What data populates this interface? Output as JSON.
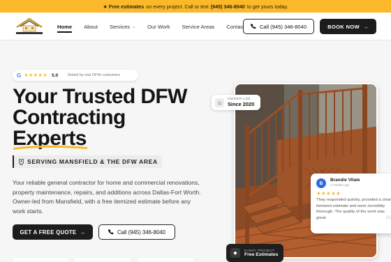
{
  "topbar": {
    "lead": "★ Free estimates",
    "middle": "on every project. Call or text",
    "phone": "(945) 346-8040",
    "tail": "to get yours today."
  },
  "nav": {
    "items": [
      {
        "label": "Home",
        "active": true
      },
      {
        "label": "About"
      },
      {
        "label": "Services",
        "has_dropdown": true
      },
      {
        "label": "Our Work"
      },
      {
        "label": "Service Areas"
      },
      {
        "label": "Contact"
      }
    ],
    "call_label": "Call (945) 346-8040",
    "book_label": "BOOK NOW"
  },
  "hero": {
    "rating_source": "G",
    "rating_stars": "★★★★★",
    "rating_score": "5.0",
    "rating_sub": "Rated by real DFW customers",
    "headline": [
      "Your Trusted DFW",
      "Contracting",
      "Experts"
    ],
    "area_tag": "SERVING MANSFIELD & THE DFW AREA",
    "description": "Your reliable general contractor for home and commercial renovations, property maintenance, repairs, and additions across Dallas-Fort Worth. Owner-led from Mansfield, with a free itemized estimate before any work starts.",
    "quote_button": "GET A FREE QUOTE",
    "call_button": "Call (945) 346-8040"
  },
  "badges": {
    "owner_small": "OWNER-LED",
    "owner_big": "Since 2020",
    "estimate_small": "EVERY PROJECT",
    "estimate_big": "Free Estimates"
  },
  "review": {
    "initial": "B",
    "name": "Brandie Vitale",
    "time": "4 months ago",
    "stars": "★★★★★",
    "text": "They responded quickly, provided a clear, itemized estimate and were incredibly thorough. The quality of the work was great."
  },
  "colors": {
    "accent": "#fbb829",
    "dark": "#1c1c1c",
    "wood": "#a2552a"
  },
  "icons": {
    "logo": "house-roof-logo",
    "call": "phone-icon",
    "arrow": "arrow-right-icon",
    "pin": "location-pin-icon",
    "home": "home-icon",
    "tag": "tag-icon",
    "quote": "quote-icon"
  }
}
